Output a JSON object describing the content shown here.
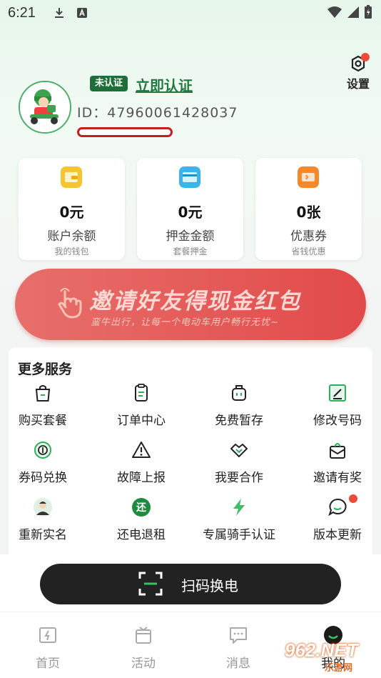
{
  "status_bar": {
    "time": "6:21"
  },
  "settings": {
    "label": "设置"
  },
  "profile": {
    "badge": "未认证",
    "verify_link": "立即认证",
    "user_id": "ID：47960061428037"
  },
  "cards": [
    {
      "value": "0元",
      "title": "账户余额",
      "subtitle": "我的钱包",
      "icon": "wallet-icon",
      "color": "#f6c431"
    },
    {
      "value": "0元",
      "title": "押金金额",
      "subtitle": "套餐押金",
      "icon": "deposit-card-icon",
      "color": "#3bb4ec"
    },
    {
      "value": "0张",
      "title": "优惠券",
      "subtitle": "省钱优惠",
      "icon": "coupon-icon",
      "color": "#f7892b"
    }
  ],
  "banner": {
    "title": "邀请好友得现金红包",
    "subtitle": "蛮牛出行，让每一个电动车用户畅行无忧~"
  },
  "services": {
    "title": "更多服务",
    "items": [
      {
        "label": "购买套餐",
        "icon": "shopping-bag-icon"
      },
      {
        "label": "订单中心",
        "icon": "clipboard-icon"
      },
      {
        "label": "免费暂存",
        "icon": "luggage-icon"
      },
      {
        "label": "修改号码",
        "icon": "edit-phone-icon"
      },
      {
        "label": "券码兑换",
        "icon": "coin-exchange-icon"
      },
      {
        "label": "故障上报",
        "icon": "warning-icon"
      },
      {
        "label": "我要合作",
        "icon": "handshake-icon"
      },
      {
        "label": "邀请有奖",
        "icon": "gift-envelope-icon"
      },
      {
        "label": "重新实名",
        "icon": "person-icon"
      },
      {
        "label": "还电退租",
        "icon": "return-badge-icon",
        "badge_char": "还"
      },
      {
        "label": "专属骑手认证",
        "icon": "lightning-icon"
      },
      {
        "label": "版本更新",
        "icon": "chat-bubble-icon"
      }
    ]
  },
  "scan_button": {
    "label": "扫码换电"
  },
  "bottom_nav": [
    {
      "label": "首页",
      "icon": "home-ticket-icon"
    },
    {
      "label": "活动",
      "icon": "calendar-gift-icon"
    },
    {
      "label": "消息",
      "icon": "message-icon"
    },
    {
      "label": "我的",
      "icon": "profile-smile-icon"
    }
  ],
  "watermark": {
    "text": "962.NET",
    "sub": "乐游网"
  },
  "colors": {
    "brand_green": "#1e6e3a",
    "accent_red": "#e24a4a",
    "dark": "#222222"
  }
}
